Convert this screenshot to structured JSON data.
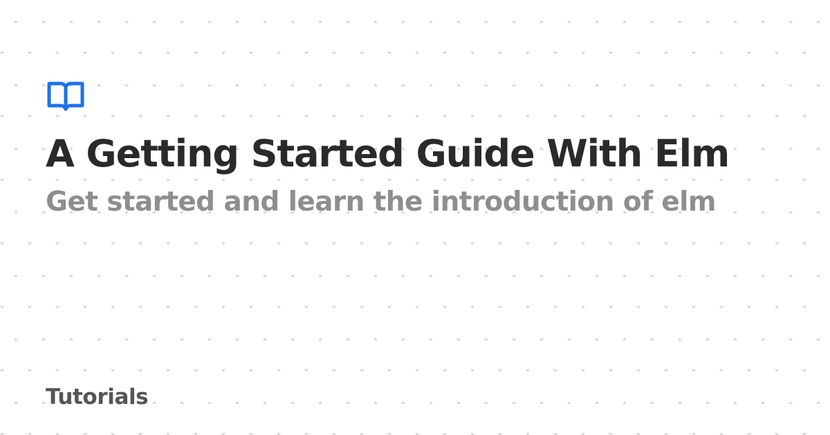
{
  "card": {
    "title": "A Getting Started Guide With Elm",
    "subtitle": "Get started and learn the introduction of elm",
    "category": "Tutorials"
  },
  "logo": {
    "icon": "open-book-icon",
    "color": "#1a73e8"
  },
  "theme": {
    "background": "#ffffff",
    "pattern_color": "#d6d6d6",
    "title_color": "#2a2a2a",
    "subtitle_color": "#8e8e8e",
    "category_color": "#555555"
  }
}
